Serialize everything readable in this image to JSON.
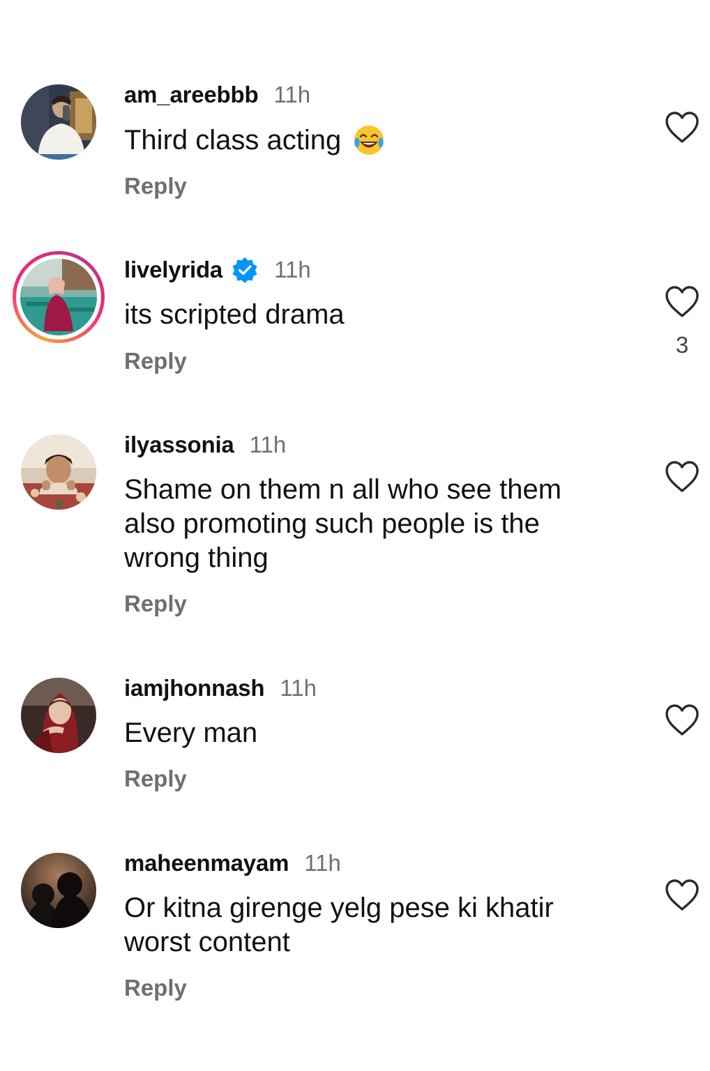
{
  "comments": [
    {
      "username": "am_areebbb",
      "time": "11h",
      "text": "Third class acting",
      "emoji": "face-with-tears-of-joy",
      "reply_label": "Reply",
      "like_count": ""
    },
    {
      "username": "livelyrida",
      "verified": true,
      "time": "11h",
      "text": "its scripted drama",
      "reply_label": "Reply",
      "like_count": "3"
    },
    {
      "username": "ilyassonia",
      "time": "11h",
      "text": "Shame on them n all who see them also promoting such people is the wrong thing",
      "reply_label": "Reply",
      "like_count": ""
    },
    {
      "username": "iamjhonnash",
      "time": "11h",
      "text": "Every man",
      "reply_label": "Reply",
      "like_count": ""
    },
    {
      "username": "maheenmayam",
      "time": "11h",
      "text": "Or kitna girenge yelg pese ki khatir worst content",
      "reply_label": "Reply",
      "like_count": ""
    }
  ],
  "icons": {
    "like": "heart-outline-icon",
    "verified": "verified-badge-icon"
  },
  "colors": {
    "text": "#111111",
    "muted": "#6f6f6f",
    "verified_blue": "#0095f6",
    "story_ring_start": "#f9a23a",
    "story_ring_end": "#c13584"
  }
}
